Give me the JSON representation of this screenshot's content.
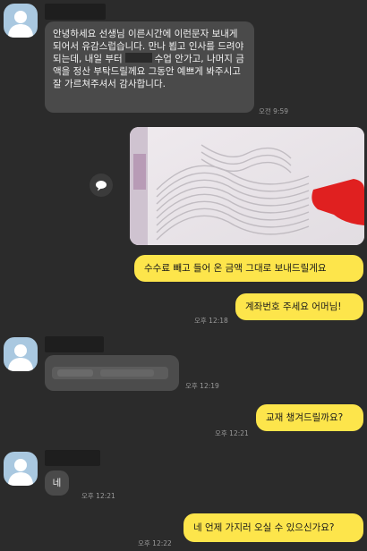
{
  "messages": {
    "m1_text": "안녕하세요 선생님 이른시간에 이런문자 보내게 되어서 유감스럽습니다. 만나 뵙고 인사를 드려야되는데, 내일 부터",
    "m1_text_after": "수업 안가고, 나머지 금액을 정산 부탁드릴께요 그동안 예쁘게 봐주시고 잘 가르쳐주셔서 감사합니다.",
    "m1_time": "오전 9:59",
    "o1_text": "수수료 빼고 들어 온 금액 그대로 보내드릴게요",
    "o2_text": "계좌번호 주세요 어머님!",
    "o2_time": "오후 12:18",
    "m2_time": "오후 12:19",
    "o3_text": "교재 챙겨드릴까요?",
    "o3_time": "오후 12:21",
    "m3_text": "네",
    "m3_time": "오후 12:21",
    "o4_text": "네 언제 가지러 오실 수 있으신가요?",
    "o4_time": "오후 12:22"
  },
  "colors": {
    "background": "#2b2b2b",
    "incoming_bubble": "#4a4a4a",
    "outgoing_bubble": "#fde54b",
    "avatar": "#a9c8e0"
  },
  "icons": {
    "avatar": "default-profile-icon",
    "share": "speech-bubble-share-icon"
  }
}
